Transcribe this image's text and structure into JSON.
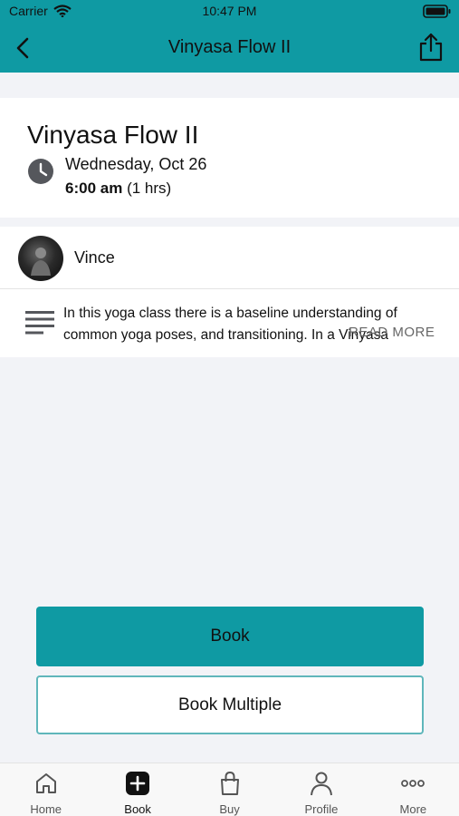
{
  "status": {
    "carrier": "Carrier",
    "time": "10:47 PM"
  },
  "nav": {
    "title": "Vinyasa Flow II"
  },
  "class": {
    "title": "Vinyasa Flow II",
    "date": "Wednesday, Oct 26",
    "time": "6:00 am",
    "duration": "(1 hrs)"
  },
  "instructor": {
    "name": "Vince"
  },
  "description": {
    "text": "In this yoga class there is a baseline understanding of common yoga poses, and transitioning. In a Vinyasa",
    "read_more": "READ MORE"
  },
  "buttons": {
    "book": "Book",
    "book_multiple": "Book Multiple"
  },
  "tabs": [
    {
      "label": "Home",
      "icon": "home-icon"
    },
    {
      "label": "Book",
      "icon": "plus-square-icon"
    },
    {
      "label": "Buy",
      "icon": "bag-icon"
    },
    {
      "label": "Profile",
      "icon": "person-icon"
    },
    {
      "label": "More",
      "icon": "more-dots-icon"
    }
  ],
  "colors": {
    "accent": "#0f9aa3",
    "background": "#f2f3f7"
  }
}
